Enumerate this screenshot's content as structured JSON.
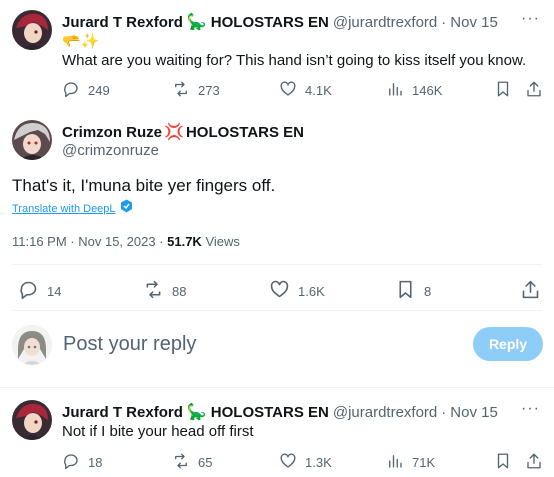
{
  "reply_1": {
    "author_name": "Jurard T Rexford",
    "author_emoji": "🦕",
    "author_suffix": "HOLOSTARS EN",
    "handle": "@jurardtrexford",
    "separator": "·",
    "date": "Nov 15",
    "emoji_line": "🫳✨",
    "text": "What are you waiting for? This hand isn’t going to kiss itself you know.",
    "replies": "249",
    "reposts": "273",
    "likes": "4.1K",
    "views": "146K"
  },
  "main_tweet": {
    "author_name": "Crimzon Ruze",
    "author_emoji": "💢",
    "author_suffix": "HOLOSTARS EN",
    "handle": "@crimzonruze",
    "text": "That's it, I'muna bite yer fingers off.",
    "translate_label": "Translate with DeepL",
    "time": "11:16 PM · Nov 15, 2023 · ",
    "views_count": "51.7K",
    "views_label": " Views",
    "replies": "14",
    "reposts": "88",
    "likes": "1.6K",
    "bookmarks": "8"
  },
  "composer": {
    "placeholder": "Post your reply",
    "reply_button": "Reply"
  },
  "reply_2": {
    "author_name": "Jurard T Rexford",
    "author_emoji": "🦕",
    "author_suffix": "HOLOSTARS EN",
    "handle": "@jurardtrexford",
    "separator": "·",
    "date": "Nov 15",
    "text": "Not if I bite your head off first",
    "replies": "18",
    "reposts": "65",
    "likes": "1.3K",
    "views": "71K"
  },
  "colors": {
    "text": "#0f1419",
    "muted": "#536471",
    "link": "#1d9bf0",
    "reply_button_disabled": "#8ecdf8"
  }
}
